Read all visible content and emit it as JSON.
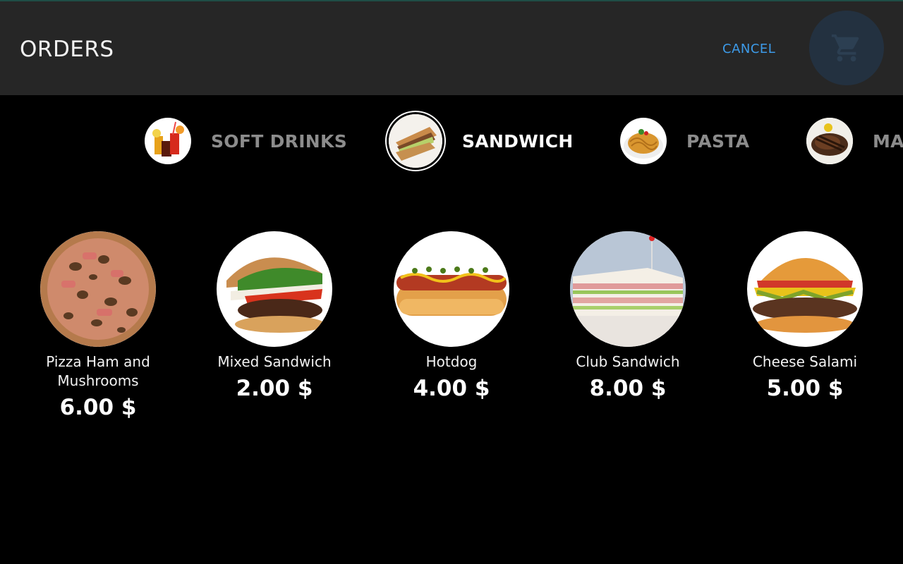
{
  "header": {
    "title": "ORDERS",
    "cancel_label": "CANCEL",
    "cart_icon": "shopping-cart-icon",
    "cart_bg": "#233140",
    "accent": "#3d9be9"
  },
  "categories": [
    {
      "label": "SOFT DRINKS",
      "icon": "soft-drinks-image",
      "active": false
    },
    {
      "label": "SANDWICH",
      "icon": "sandwich-image",
      "active": true
    },
    {
      "label": "PASTA",
      "icon": "pasta-image",
      "active": false
    },
    {
      "label": "MA",
      "icon": "meat-image",
      "active": false
    }
  ],
  "products": [
    {
      "name": "Pizza Ham and Mushrooms",
      "price": "6.00 $",
      "image": "pizza-image"
    },
    {
      "name": "Mixed Sandwich",
      "price": "2.00 $",
      "image": "burger-image"
    },
    {
      "name": "Hotdog",
      "price": "4.00 $",
      "image": "hotdog-image"
    },
    {
      "name": "Club Sandwich",
      "price": "8.00 $",
      "image": "club-sandwich-image"
    },
    {
      "name": "Cheese Salami",
      "price": "5.00 $",
      "image": "cheeseburger-image"
    }
  ]
}
